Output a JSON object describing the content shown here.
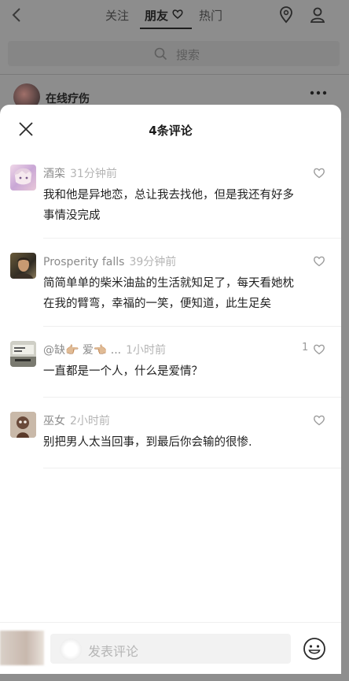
{
  "background": {
    "tabs": [
      {
        "label": "关注",
        "active": false
      },
      {
        "label": "朋友",
        "active": true
      },
      {
        "label": "热门",
        "active": false
      }
    ],
    "search_placeholder": "搜索",
    "post_author": "在线疗伤"
  },
  "sheet": {
    "title": "4条评论"
  },
  "comments": [
    {
      "name": "酒栾",
      "time": "31分钟前",
      "text": "我和他是异地恋，总让我去找他，但是我还有好多事情没完成",
      "likes": ""
    },
    {
      "name": "Prosperity  falls",
      "time": "39分钟前",
      "text": "简简单单的柴米油盐的生活就知足了，每天看她枕在我的臂弯，幸福的一笑，便知道，此生足矣",
      "likes": ""
    },
    {
      "name": "@缺👉🏼 爱👈🏼 ...",
      "time": "1小时前",
      "text": "一直都是一个人，什么是爱情？",
      "likes": "1"
    },
    {
      "name": "巫女",
      "time": "2小时前",
      "text": "别把男人太当回事，到最后你会输的很惨.",
      "likes": ""
    }
  ],
  "input": {
    "placeholder": "发表评论"
  },
  "colors": {
    "overlay": "#8e8e8e",
    "sheet": "#ffffff",
    "muted_text": "#8a8a8a"
  }
}
